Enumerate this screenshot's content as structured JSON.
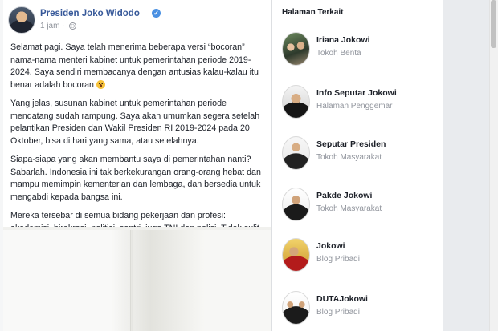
{
  "post": {
    "author": "Presiden Joko Widodo",
    "time": "1 jam",
    "paragraphs": [
      "Selamat pagi. Saya telah menerima beberapa versi “bocoran” nama-nama menteri kabinet untuk pemerintahan periode 2019-2024. Saya sendiri membacanya dengan antusias kalau-kalau itu benar adalah bocoran",
      "Yang jelas, susunan kabinet untuk pemerintahan periode mendatang sudah rampung. Saya akan umumkan segera setelah pelantikan Presiden dan Wakil Presiden RI 2019-2024 pada 20 Oktober, bisa di hari yang sama, atau setelahnya.",
      "Siapa-siapa yang akan membantu saya di pemerintahan nanti? Sabarlah. Indonesia ini tak berkekurangan orang-orang hebat dan mampu memimpin kementerian dan lembaga, dan bersedia untuk mengabdi kepada bangsa ini.",
      "Mereka tersebar di semua bidang pekerjaan dan profesi: akademisi, birokrasi, politisi, santri, juga TNI dan polisi. Tidak sulit menemukan mereka."
    ]
  },
  "sidebar": {
    "title": "Halaman Terkait",
    "items": [
      {
        "name": "Iriana Jokowi",
        "category": "Tokoh Benta"
      },
      {
        "name": "Info Seputar Jokowi",
        "category": "Halaman Penggemar"
      },
      {
        "name": "Seputar Presiden",
        "category": "Tokoh Masyarakat"
      },
      {
        "name": "Pakde Jokowi",
        "category": "Tokoh Masyarakat"
      },
      {
        "name": "Jokowi",
        "category": "Blog Pribadi"
      },
      {
        "name": "DUTAJokowi",
        "category": "Blog Pribadi"
      }
    ]
  },
  "icons": {
    "verified": "verified-badge-icon",
    "privacy": "globe-icon",
    "emoji": "grinning-face-icon"
  },
  "colors": {
    "link": "#365899",
    "text": "#1d2129",
    "muted": "#90949c",
    "background": "#e9ebee"
  }
}
